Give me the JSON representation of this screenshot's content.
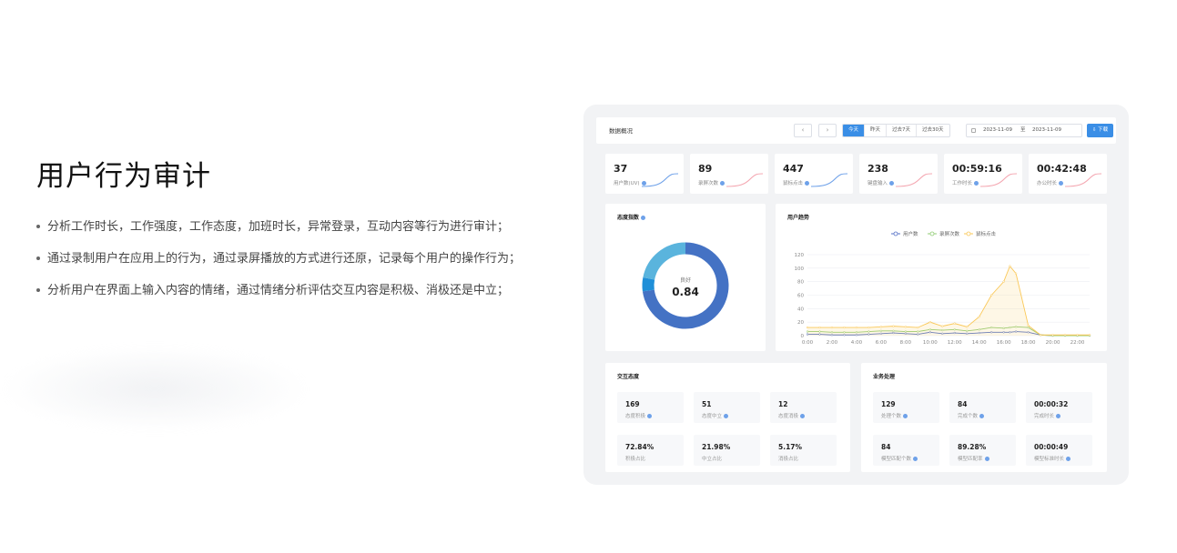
{
  "hero": {
    "title": "用户行为审计",
    "bullets": [
      "分析工作时长，工作强度，工作态度，加班时长，异常登录，互动内容等行为进行审计；",
      "通过录制用户在应用上的行为，通过录屏播放的方式进行还原，记录每个用户的操作行为；",
      "分析用户在界面上输入内容的情绪，通过情绪分析评估交互内容是积极、消极还是中立；"
    ]
  },
  "dashboard": {
    "title": "数据概况",
    "nav_prev": "‹",
    "nav_next": "›",
    "ranges": [
      "今天",
      "昨天",
      "过去7天",
      "过去30天"
    ],
    "selected_range": "今天",
    "date_from": "2023-11-09",
    "date_sep": "至",
    "date_to": "2023-11-09",
    "download": "⇩ 下载",
    "accent": "#3a8ee6",
    "stats": [
      {
        "value": "37",
        "label": "用户数(UV)"
      },
      {
        "value": "89",
        "label": "录屏次数"
      },
      {
        "value": "447",
        "label": "鼠标点击"
      },
      {
        "value": "238",
        "label": "键盘输入"
      },
      {
        "value": "00:59:16",
        "label": "工作时长"
      },
      {
        "value": "00:42:48",
        "label": "办公时长"
      }
    ],
    "attitude": {
      "title": "态度指数",
      "label": "良好",
      "value": "0.84"
    },
    "trend": {
      "title": "用户趋势"
    },
    "interaction": {
      "title": "交互态度",
      "tiles": [
        {
          "value": "169",
          "label": "态度积极"
        },
        {
          "value": "51",
          "label": "态度中立"
        },
        {
          "value": "12",
          "label": "态度消极"
        },
        {
          "value": "72.84%",
          "label": "积极占比"
        },
        {
          "value": "21.98%",
          "label": "中立占比"
        },
        {
          "value": "5.17%",
          "label": "消极占比"
        }
      ]
    },
    "business": {
      "title": "业务处理",
      "tiles": [
        {
          "value": "129",
          "label": "处理个数"
        },
        {
          "value": "84",
          "label": "完成个数"
        },
        {
          "value": "00:00:32",
          "label": "完成时长"
        },
        {
          "value": "84",
          "label": "模型匹配个数"
        },
        {
          "value": "89.28%",
          "label": "模型匹配率"
        },
        {
          "value": "00:00:49",
          "label": "模型标准时长"
        }
      ]
    }
  },
  "chart_data": [
    {
      "type": "pie",
      "title": "态度指数",
      "center_label": "良好",
      "center_value": "0.84",
      "values": [
        72.84,
        5.17,
        21.98
      ],
      "colors": [
        "#4472c4",
        "#1f8fd8",
        "#5ab4dd"
      ]
    },
    {
      "type": "line",
      "title": "用户趋势",
      "x": [
        "0:00",
        "1:00",
        "2:00",
        "3:00",
        "4:00",
        "5:00",
        "6:00",
        "7:00",
        "8:00",
        "9:00",
        "10:00",
        "11:00",
        "12:00",
        "13:00",
        "14:00",
        "15:00",
        "16:00",
        "16:30",
        "17:00",
        "18:00",
        "19:00",
        "20:00",
        "21:00",
        "22:00",
        "23:00"
      ],
      "xticks": [
        "0:00",
        "2:00",
        "4:00",
        "6:00",
        "8:00",
        "10:00",
        "12:00",
        "14:00",
        "16:00",
        "18:00",
        "20:00",
        "22:00"
      ],
      "ylim": [
        0,
        120
      ],
      "yticks": [
        0,
        20,
        40,
        60,
        80,
        100,
        120
      ],
      "grid": true,
      "legend": "top-center",
      "series": [
        {
          "name": "用户数",
          "color": "#5470c6",
          "values": [
            2,
            2,
            1,
            1,
            1,
            2,
            3,
            4,
            3,
            2,
            5,
            3,
            4,
            3,
            4,
            5,
            5,
            5,
            6,
            5,
            1,
            0,
            0,
            0,
            0
          ]
        },
        {
          "name": "录屏次数",
          "color": "#91cc75",
          "values": [
            6,
            6,
            5,
            5,
            5,
            6,
            7,
            7,
            6,
            6,
            9,
            8,
            9,
            7,
            9,
            12,
            11,
            12,
            13,
            12,
            1,
            0,
            0,
            0,
            0
          ]
        },
        {
          "name": "鼠标点击",
          "color": "#fac858",
          "values": [
            12,
            12,
            12,
            12,
            12,
            12,
            13,
            14,
            13,
            12,
            20,
            14,
            18,
            13,
            28,
            60,
            80,
            103,
            92,
            15,
            1,
            1,
            1,
            1,
            1
          ]
        }
      ]
    }
  ]
}
